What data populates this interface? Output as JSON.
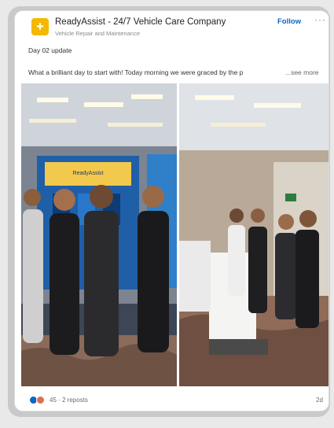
{
  "post": {
    "company_name": "ReadyAssist - 24/7 Vehicle Care Company",
    "company_subtitle": "Vehicle Repair and Maintenance",
    "follow_label": "Follow",
    "more_label": "···",
    "title": "Day 02 update",
    "text": "What a brilliant day to start with! Today morning we were graced by the p",
    "see_more_label": "...see more",
    "reactions": "45 · 2 reposts",
    "time": "2d"
  },
  "booth_sign": "ReadyAssist",
  "colors": {
    "accent": "#0a66c2",
    "logo": "#f5b800",
    "booth": "#1f5fa8"
  },
  "icons": {
    "logo": "ready-assist-logo",
    "like": "like-icon",
    "celebrate": "celebrate-icon"
  }
}
